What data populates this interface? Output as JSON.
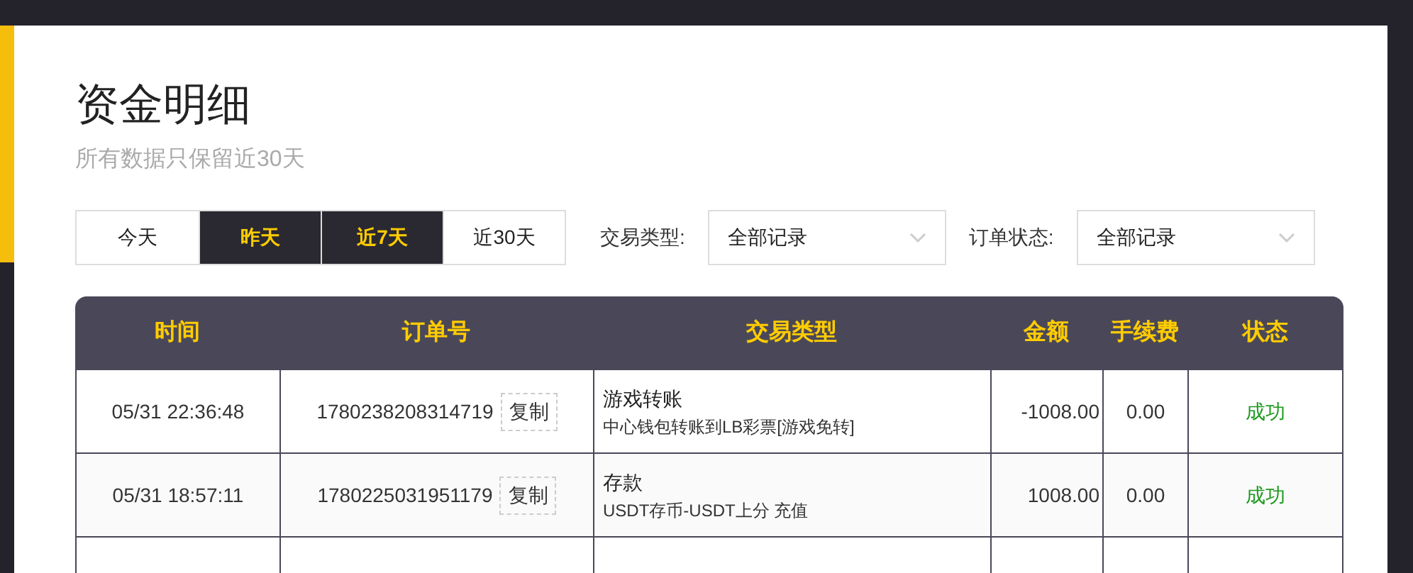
{
  "title": "资金明细",
  "subtitle": "所有数据只保留近30天",
  "date_tabs": [
    {
      "label": "今天",
      "selected": false
    },
    {
      "label": "昨天",
      "selected": true
    },
    {
      "label": "近7天",
      "selected": true
    },
    {
      "label": "近30天",
      "selected": false
    }
  ],
  "filters": [
    {
      "label": "交易类型:",
      "value": "全部记录"
    },
    {
      "label": "订单状态:",
      "value": "全部记录"
    }
  ],
  "table": {
    "columns": [
      "时间",
      "订单号",
      "交易类型",
      "金额",
      "手续费",
      "状态"
    ],
    "rows": [
      {
        "time": "05/31 22:36:48",
        "order": "1780238208314719",
        "copy_label": "复制",
        "type": "游戏转账",
        "detail": "中心钱包转账到LB彩票[游戏免转]",
        "amount": "-1008.00",
        "fee": "0.00",
        "status": "成功",
        "color": "#1e9a1e"
      },
      {
        "time": "05/31 18:57:11",
        "order": "1780225031951179",
        "copy_label": "复制",
        "type": "存款",
        "detail": "USDT存币-USDT上分 充值",
        "amount": "1008.00",
        "fee": "0.00",
        "status": "成功",
        "color": "#1e9a1e"
      }
    ]
  }
}
